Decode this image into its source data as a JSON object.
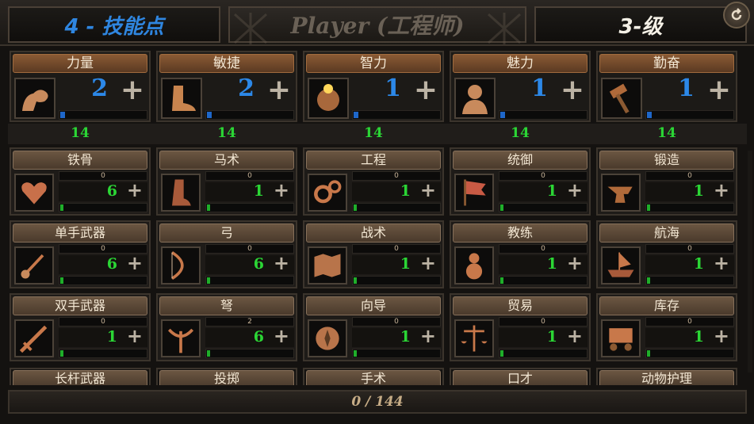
{
  "header": {
    "skill_points": "4 - 技能点",
    "player": "Player (工程师)",
    "level": "3-级"
  },
  "attributes": [
    {
      "label": "力量",
      "value": "2",
      "cap": "14",
      "icon": "flexed-arm-icon",
      "progress": 0.05
    },
    {
      "label": "敏捷",
      "value": "2",
      "cap": "14",
      "icon": "boot-icon",
      "progress": 0.05
    },
    {
      "label": "智力",
      "value": "1",
      "cap": "14",
      "icon": "glowing-head-icon",
      "progress": 0.05
    },
    {
      "label": "魅力",
      "value": "1",
      "cap": "14",
      "icon": "bald-man-icon",
      "progress": 0.05
    },
    {
      "label": "勤奋",
      "value": "1",
      "cap": "14",
      "icon": "hammer-icon",
      "progress": 0.05
    }
  ],
  "skills": [
    {
      "label": "铁骨",
      "exp": "0",
      "value": "6",
      "icon": "heart-icon"
    },
    {
      "label": "马术",
      "exp": "0",
      "value": "1",
      "icon": "riding-boot-icon"
    },
    {
      "label": "工程",
      "exp": "0",
      "value": "1",
      "icon": "gears-icon"
    },
    {
      "label": "统御",
      "exp": "0",
      "value": "1",
      "icon": "flag-icon"
    },
    {
      "label": "锻造",
      "exp": "0",
      "value": "1",
      "icon": "anvil-icon"
    },
    {
      "label": "单手武器",
      "exp": "0",
      "value": "6",
      "icon": "sword-hand-icon"
    },
    {
      "label": "弓",
      "exp": "0",
      "value": "6",
      "icon": "bow-icon"
    },
    {
      "label": "战术",
      "exp": "0",
      "value": "1",
      "icon": "map-icon"
    },
    {
      "label": "教练",
      "exp": "0",
      "value": "1",
      "icon": "training-dummy-icon"
    },
    {
      "label": "航海",
      "exp": "0",
      "value": "1",
      "icon": "ship-icon"
    },
    {
      "label": "双手武器",
      "exp": "0",
      "value": "1",
      "icon": "greatsword-icon"
    },
    {
      "label": "弩",
      "exp": "2",
      "value": "6",
      "icon": "crossbow-icon"
    },
    {
      "label": "向导",
      "exp": "0",
      "value": "1",
      "icon": "compass-icon"
    },
    {
      "label": "贸易",
      "exp": "0",
      "value": "1",
      "icon": "scales-icon"
    },
    {
      "label": "库存",
      "exp": "0",
      "value": "1",
      "icon": "cart-icon"
    }
  ],
  "partial_skills": [
    "长杆武器",
    "投掷",
    "手术",
    "口才",
    "动物护理"
  ],
  "footer": {
    "progress": "0 / 144"
  },
  "colors": {
    "attr_value": "#2c88e8",
    "skill_value": "#2bd635",
    "skill_points": "#2f86e0"
  }
}
